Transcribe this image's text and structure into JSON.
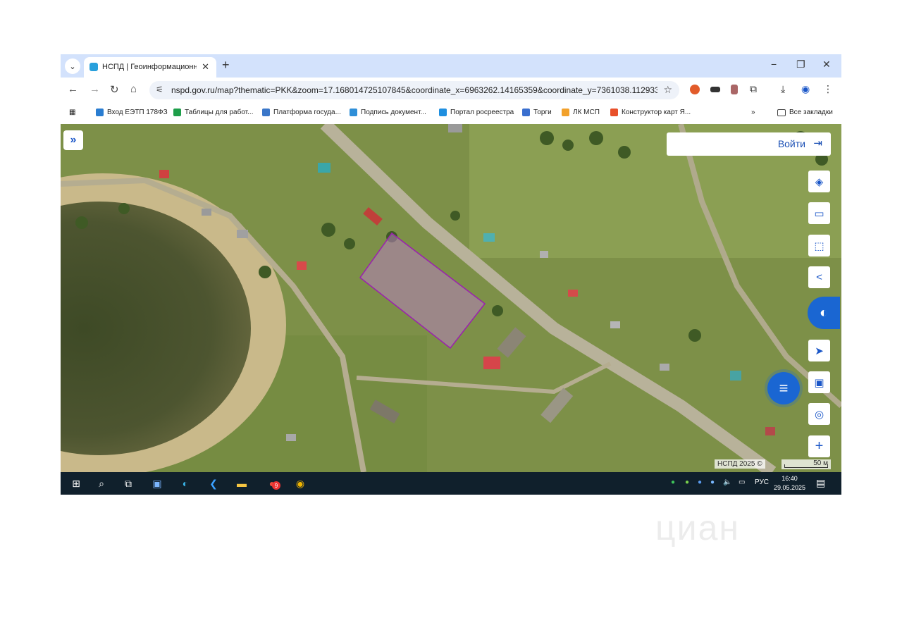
{
  "tab": {
    "title": "НСПД | Геоинформационный",
    "close": "✕"
  },
  "toolbar": {
    "url": "nspd.gov.ru/map?thematic=PKK&zoom=17.168014725107845&coordinate_x=6963262.14165359&coordinate_y=7361038.11293319&..."
  },
  "bookmarks": {
    "items": [
      {
        "label": "Вход ЕЭТП 178ФЗ",
        "color": "#2a7dd1"
      },
      {
        "label": "Таблицы для работ...",
        "color": "#1e9e4a"
      },
      {
        "label": "Платформа госуда...",
        "color": "#3b77c9"
      },
      {
        "label": "Подпись документ...",
        "color": "#2f8fd8"
      },
      {
        "label": "Портал росреестра",
        "color": "#1f8fe0"
      },
      {
        "label": "Торги",
        "color": "#3a6fcf"
      },
      {
        "label": "ЛК МСП",
        "color": "#f2a12b"
      },
      {
        "label": "Конструктор карт Я...",
        "color": "#e8502a"
      }
    ],
    "more": "»",
    "all_label": "Все закладки"
  },
  "map": {
    "login_label": "Войти",
    "attribution": "НСПД 2025 ©",
    "scale_label": "50 м",
    "parcel_color": "#9b1fb0"
  },
  "taskbar": {
    "language": "РУС",
    "time": "16:40",
    "date": "29.05.2025",
    "badge": "9"
  },
  "watermark": "циан"
}
